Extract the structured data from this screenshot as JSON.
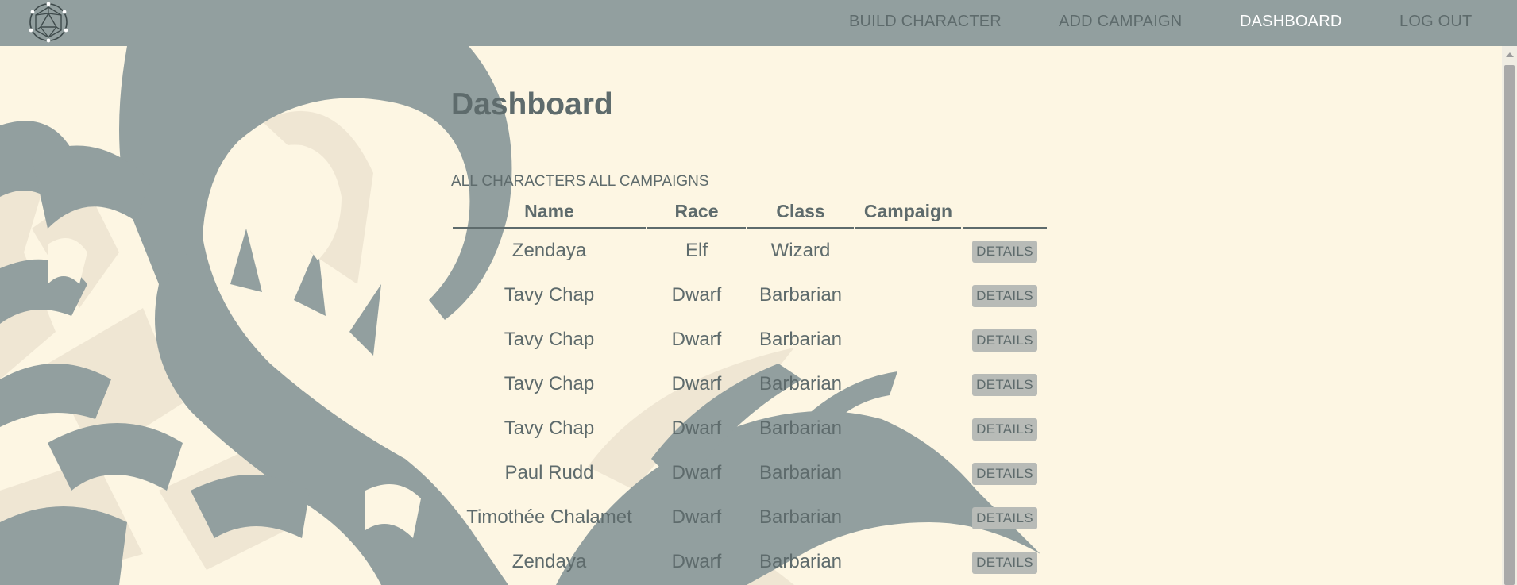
{
  "nav": {
    "build_character": "BUILD CHARACTER",
    "add_campaign": "ADD CAMPAIGN",
    "dashboard": "DASHBOARD",
    "logout": "LOG OUT"
  },
  "page": {
    "title": "Dashboard",
    "tabs": [
      "ALL CHARACTERS",
      "ALL CAMPAIGNS"
    ]
  },
  "table": {
    "headers": [
      "Name",
      "Race",
      "Class",
      "Campaign",
      ""
    ],
    "rows": [
      {
        "name": "Zendaya",
        "race": "Elf",
        "class": "Wizard",
        "campaign": "",
        "action": "DETAILS"
      },
      {
        "name": "Tavy Chap",
        "race": "Dwarf",
        "class": "Barbarian",
        "campaign": "",
        "action": "DETAILS"
      },
      {
        "name": "Tavy Chap",
        "race": "Dwarf",
        "class": "Barbarian",
        "campaign": "",
        "action": "DETAILS"
      },
      {
        "name": "Tavy Chap",
        "race": "Dwarf",
        "class": "Barbarian",
        "campaign": "",
        "action": "DETAILS"
      },
      {
        "name": "Tavy Chap",
        "race": "Dwarf",
        "class": "Barbarian",
        "campaign": "",
        "action": "DETAILS"
      },
      {
        "name": "Paul Rudd",
        "race": "Dwarf",
        "class": "Barbarian",
        "campaign": "",
        "action": "DETAILS"
      },
      {
        "name": "Timothée Chalamet",
        "race": "Dwarf",
        "class": "Barbarian",
        "campaign": "",
        "action": "DETAILS"
      },
      {
        "name": "Zendaya",
        "race": "Dwarf",
        "class": "Barbarian",
        "campaign": "",
        "action": "DETAILS"
      }
    ]
  },
  "colors": {
    "navbar": "#929f9f",
    "background": "#fdf6e3",
    "text": "#5e6b6c",
    "active_nav": "#ffffff",
    "button": "#b8bbb7",
    "dragon_shape": "#929f9f",
    "dragon_shadow": "#efe6d3"
  },
  "icons": {
    "logo": "d20-dice-icon",
    "background": "dragon-silhouette"
  }
}
